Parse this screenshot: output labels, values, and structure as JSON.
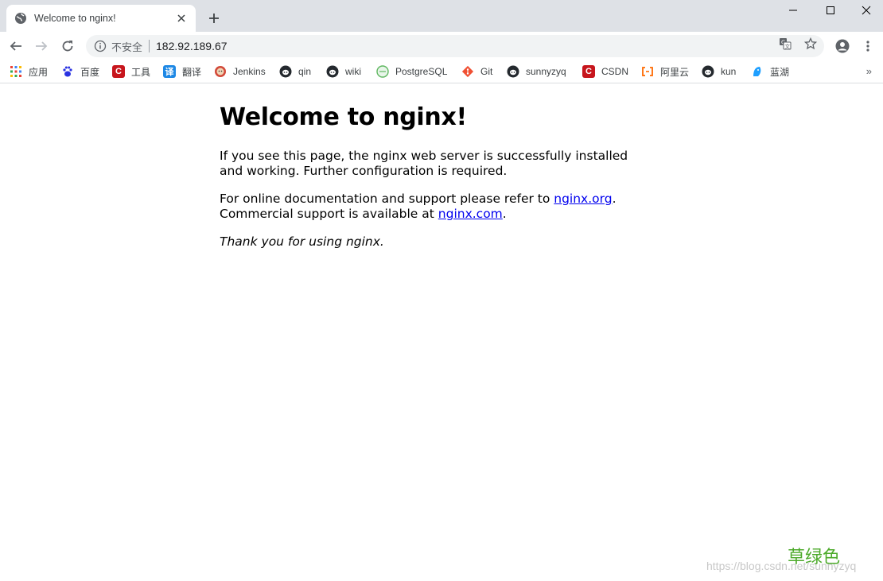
{
  "browser": {
    "tab": {
      "title": "Welcome to nginx!",
      "favicon": "globe-icon"
    },
    "window_controls": [
      "minimize-icon",
      "maximize-icon",
      "close-icon"
    ],
    "toolbar": {
      "security_label": "不安全",
      "url": "182.92.189.67"
    },
    "bookmarks": [
      {
        "label": "应用",
        "icon": "apps-grid-icon",
        "color": "#e8453c"
      },
      {
        "label": "百度",
        "icon": "baidu-paw-icon",
        "color": "#2932e1"
      },
      {
        "label": "工具",
        "icon": "csdn-c-icon",
        "color": "#c7161d"
      },
      {
        "label": "翻译",
        "icon": "translate-icon",
        "color": "#1e88e5"
      },
      {
        "label": "Jenkins",
        "icon": "jenkins-icon",
        "color": "#d24939"
      },
      {
        "label": "qin",
        "icon": "github-icon",
        "color": "#24292e"
      },
      {
        "label": "wiki",
        "icon": "github-icon",
        "color": "#24292e"
      },
      {
        "label": "PostgreSQL",
        "icon": "postgresql-icon",
        "color": "#5fb760"
      },
      {
        "label": "Git",
        "icon": "git-icon",
        "color": "#f05033"
      },
      {
        "label": "sunnyzyq",
        "icon": "github-icon",
        "color": "#24292e"
      },
      {
        "label": "CSDN",
        "icon": "csdn-c-icon",
        "color": "#c7161d"
      },
      {
        "label": "阿里云",
        "icon": "aliyun-icon",
        "color": "#ff6a00"
      },
      {
        "label": "kun",
        "icon": "github-icon",
        "color": "#24292e"
      },
      {
        "label": "蓝湖",
        "icon": "lanhu-icon",
        "color": "#1e9fff"
      }
    ],
    "bookmarks_overflow": "»"
  },
  "page": {
    "heading": "Welcome to nginx!",
    "para1": "If you see this page, the nginx web server is successfully installed and working. Further configuration is required.",
    "para2_prefix": "For online documentation and support please refer to ",
    "link_org": "nginx.org",
    "para2_mid": ".",
    "para2_line2_prefix": "Commercial support is available at ",
    "link_com": "nginx.com",
    "para2_suffix": ".",
    "thanks": "Thank you for using nginx."
  },
  "watermark": {
    "green_text": "草绿色",
    "url_text": "https://blog.csdn.net/sunnyzyq"
  }
}
